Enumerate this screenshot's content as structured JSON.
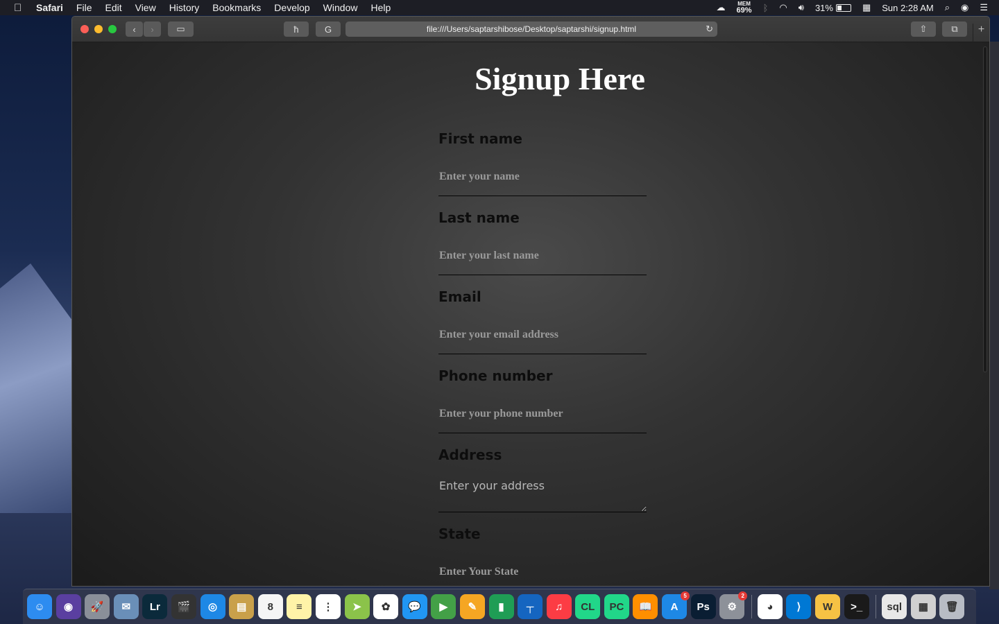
{
  "menubar": {
    "app": "Safari",
    "items": [
      "File",
      "Edit",
      "View",
      "History",
      "Bookmarks",
      "Develop",
      "Window",
      "Help"
    ],
    "mem_label": "MEM",
    "mem_value": "69%",
    "battery": "31%",
    "clock": "Sun 2:28 AM"
  },
  "browser": {
    "url": "file:///Users/saptarshibose/Desktop/saptarshi/signup.html"
  },
  "page": {
    "title": "Signup Here",
    "fields": [
      {
        "label": "First name",
        "placeholder": "Enter your name"
      },
      {
        "label": "Last name",
        "placeholder": "Enter your last name"
      },
      {
        "label": "Email",
        "placeholder": "Enter your email address"
      },
      {
        "label": "Phone number",
        "placeholder": "Enter your phone number"
      },
      {
        "label": "Address",
        "placeholder": "Enter your address"
      },
      {
        "label": "State",
        "placeholder": "Enter Your State"
      }
    ]
  },
  "dock": {
    "calendar_day": "8",
    "appstore_badge": "5",
    "prefs_badge": "2",
    "apps": [
      {
        "name": "finder",
        "color": "#2d8cf0",
        "glyph": "☺"
      },
      {
        "name": "siri",
        "color": "#5a3fa0",
        "glyph": "◉"
      },
      {
        "name": "launchpad",
        "color": "#8a8f99",
        "glyph": "🚀"
      },
      {
        "name": "mail-bird",
        "color": "#6a8fb8",
        "glyph": "✉"
      },
      {
        "name": "lightroom",
        "color": "#0b2a3b",
        "glyph": "Lr"
      },
      {
        "name": "final-cut",
        "color": "#333",
        "glyph": "🎬"
      },
      {
        "name": "safari",
        "color": "#1e88e5",
        "glyph": "◎"
      },
      {
        "name": "notefile",
        "color": "#c9a04a",
        "glyph": "▤"
      },
      {
        "name": "calendar",
        "color": "#f5f5f5",
        "glyph": "8"
      },
      {
        "name": "notes",
        "color": "#fff3a8",
        "glyph": "≡"
      },
      {
        "name": "reminders",
        "color": "#ffffff",
        "glyph": "⋮"
      },
      {
        "name": "maps",
        "color": "#8bc34a",
        "glyph": "➤"
      },
      {
        "name": "photos",
        "color": "#ffffff",
        "glyph": "✿"
      },
      {
        "name": "messages",
        "color": "#2196f3",
        "glyph": "💬"
      },
      {
        "name": "facetime",
        "color": "#43a047",
        "glyph": "▶"
      },
      {
        "name": "pages",
        "color": "#f5a623",
        "glyph": "✎"
      },
      {
        "name": "numbers",
        "color": "#1f9d55",
        "glyph": "▮"
      },
      {
        "name": "keynote",
        "color": "#1565c0",
        "glyph": "┬"
      },
      {
        "name": "music",
        "color": "#fc3c44",
        "glyph": "♫"
      },
      {
        "name": "clion",
        "color": "#21d789",
        "glyph": "CL"
      },
      {
        "name": "pycharm",
        "color": "#21d789",
        "glyph": "PC"
      },
      {
        "name": "books",
        "color": "#ff8f00",
        "glyph": "📖"
      },
      {
        "name": "app-store",
        "color": "#1e88e5",
        "glyph": "A"
      },
      {
        "name": "photoshop",
        "color": "#0a1e33",
        "glyph": "Ps"
      },
      {
        "name": "system-prefs",
        "color": "#8d9199",
        "glyph": "⚙"
      },
      {
        "name": "chrome",
        "color": "#ffffff",
        "glyph": "◕"
      },
      {
        "name": "vscode",
        "color": "#0078d4",
        "glyph": "⟩"
      },
      {
        "name": "wunderlist",
        "color": "#f6c244",
        "glyph": "W"
      },
      {
        "name": "terminal",
        "color": "#1a1a1a",
        "glyph": ">_"
      },
      {
        "name": "sql-file",
        "color": "#e8e8e8",
        "glyph": "sql"
      },
      {
        "name": "screenshot-stack",
        "color": "#d0d0d0",
        "glyph": "▦"
      },
      {
        "name": "trash",
        "color": "#b8bcc4",
        "glyph": "🗑"
      }
    ]
  }
}
